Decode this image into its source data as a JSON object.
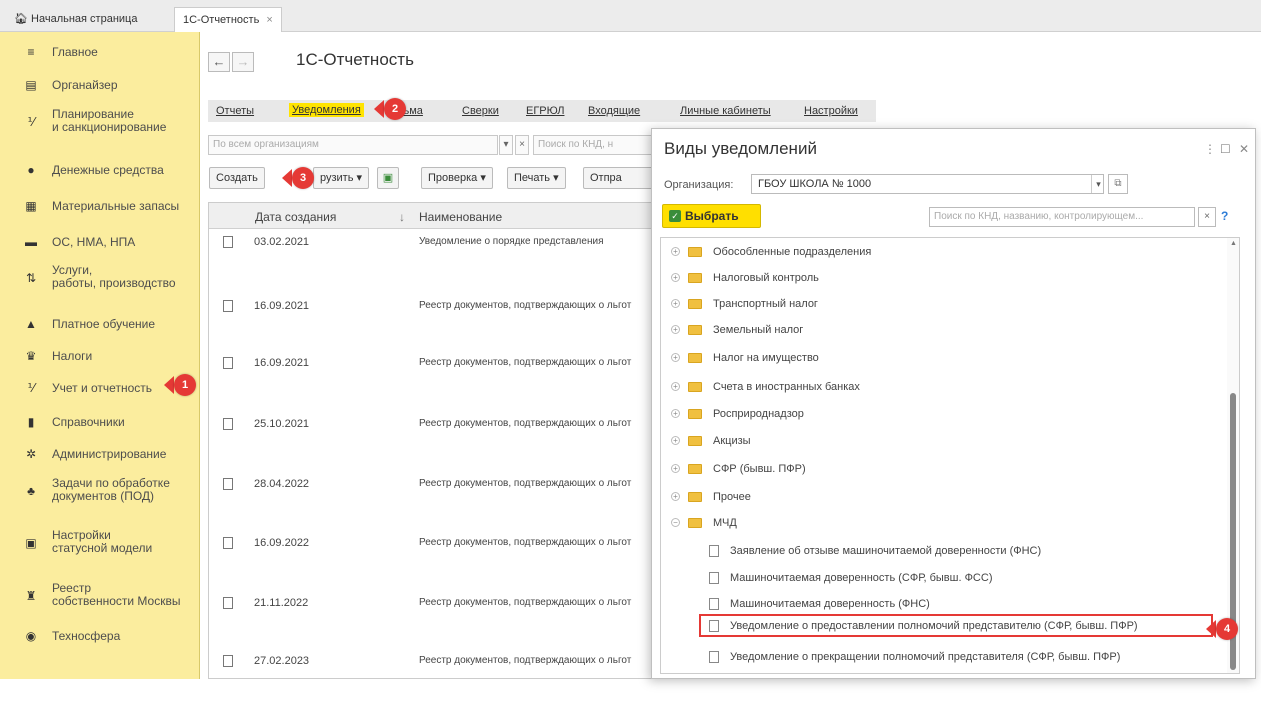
{
  "tabs": {
    "home_label": "Начальная страница",
    "active_label": "1С-Отчетность"
  },
  "sidebar": {
    "items": [
      {
        "label": "Главное",
        "icon": "menu-icon"
      },
      {
        "label": "Органайзер",
        "icon": "calendar-icon"
      },
      {
        "label": "Планирование\nи санкционирование",
        "icon": "planning-icon"
      },
      {
        "label": "Денежные средства",
        "icon": "money-icon"
      },
      {
        "label": "Материальные запасы",
        "icon": "inventory-icon"
      },
      {
        "label": "ОС, НМА, НПА",
        "icon": "truck-icon"
      },
      {
        "label": "Услуги,\nработы, производство",
        "icon": "services-icon"
      },
      {
        "label": "Платное обучение",
        "icon": "graduation-cap-icon"
      },
      {
        "label": "Налоги",
        "icon": "taxes-icon"
      },
      {
        "label": "Учет и отчетность",
        "icon": "accounting-icon"
      },
      {
        "label": "Справочники",
        "icon": "book-icon"
      },
      {
        "label": "Администрирование",
        "icon": "gear-icon"
      },
      {
        "label": "Задачи по обработке\nдокументов (ПОД)",
        "icon": "tasks-icon"
      },
      {
        "label": "Настройки\nстатусной модели",
        "icon": "settings-doc-icon"
      },
      {
        "label": "Реестр\nсобственности Москвы",
        "icon": "registry-icon"
      },
      {
        "label": "Техносфера",
        "icon": "technosphere-icon"
      }
    ]
  },
  "main": {
    "title": "1С-Отчетность",
    "sections": [
      "Отчеты",
      "Уведомления",
      "Письма",
      "Сверки",
      "ЕГРЮЛ",
      "Входящие",
      "Личные кабинеты",
      "Настройки"
    ],
    "sections_visible": {
      "letters": "сьма"
    },
    "filter_org_placeholder": "По всем организациям",
    "filter_search_placeholder": "Поиск по КНД, н",
    "toolbar": {
      "create": "Создать",
      "upload": "рузить",
      "check": "Проверка",
      "print": "Печать",
      "send": "Отпра"
    },
    "columns": {
      "date": "Дата создания",
      "name": "Наименование",
      "sort": "↓"
    },
    "rows": [
      {
        "date": "03.02.2021",
        "name": "Уведомление о порядке представления"
      },
      {
        "date": "16.09.2021",
        "name": "Реестр документов, подтверждающих о льгот"
      },
      {
        "date": "16.09.2021",
        "name": "Реестр документов, подтверждающих о льгот"
      },
      {
        "date": "25.10.2021",
        "name": "Реестр документов, подтверждающих о льгот"
      },
      {
        "date": "28.04.2022",
        "name": "Реестр документов, подтверждающих о льгот"
      },
      {
        "date": "16.09.2022",
        "name": "Реестр документов, подтверждающих о льгот"
      },
      {
        "date": "21.11.2022",
        "name": "Реестр документов, подтверждающих о льгот"
      },
      {
        "date": "27.02.2023",
        "name": "Реестр документов, подтверждающих о льгот"
      }
    ]
  },
  "dialog": {
    "title": "Виды уведомлений",
    "org_label": "Организация:",
    "org_value": "ГБОУ ШКОЛА № 1000",
    "choose_label": "Выбрать",
    "search_placeholder": "Поиск по КНД, названию, контролирующем...",
    "help": "?",
    "groups": [
      "Обособленные подразделения",
      "Налоговый контроль",
      "Транспортный налог",
      "Земельный налог",
      "Налог на имущество",
      "Счета в иностранных банках",
      "Росприроднадзор",
      "Акцизы",
      "СФР (бывш. ПФР)",
      "Прочее",
      "МЧД"
    ],
    "leaves": [
      "Заявление об отзыве машиночитаемой доверенности (ФНС)",
      "Машиночитаемая доверенность (СФР, бывш. ФСС)",
      "Машиночитаемая доверенность (ФНС)",
      "Уведомление о предоставлении полномочий представителю (СФР, бывш. ПФР)",
      "Уведомление о прекращении полномочий представителя (СФР, бывш. ПФР)"
    ]
  },
  "markers": [
    "1",
    "2",
    "3",
    "4"
  ],
  "colors": {
    "sidebar_bg": "#fbed9e",
    "accent": "#ffdf00",
    "marker": "#e53935"
  }
}
